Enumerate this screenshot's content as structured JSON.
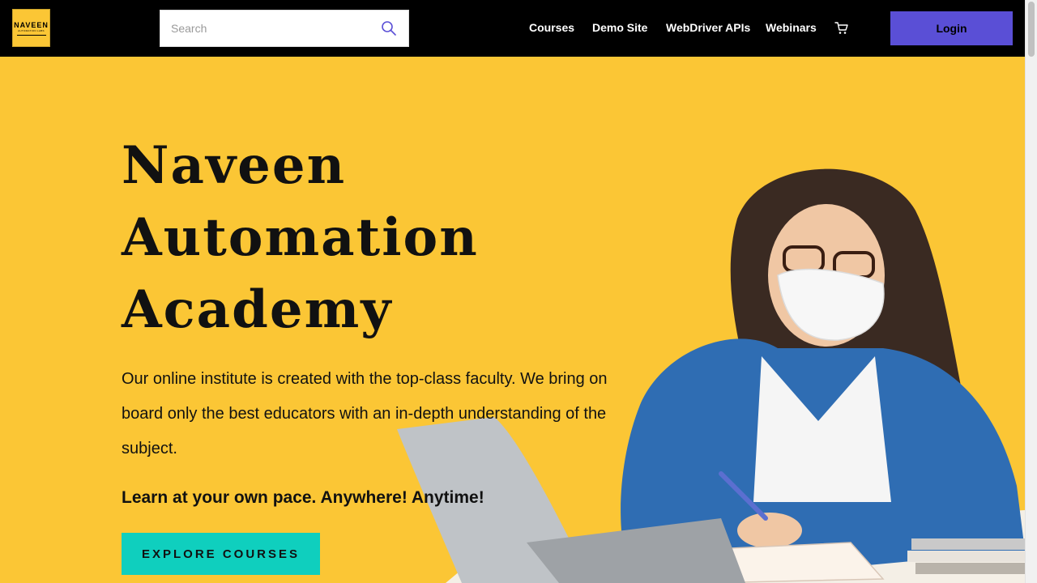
{
  "header": {
    "logo": {
      "line1": "NAVEEN",
      "line2": "AUTOMATION LABS"
    },
    "search": {
      "placeholder": "Search",
      "value": "",
      "icon": "search-icon"
    },
    "nav": [
      {
        "label": "Courses"
      },
      {
        "label": "Demo Site"
      },
      {
        "label": "WebDriver APIs"
      },
      {
        "label": "Webinars"
      }
    ],
    "cart_icon": "cart-icon",
    "login_label": "Login"
  },
  "hero": {
    "title_lines": [
      "Naveen",
      "Automation",
      "Academy"
    ],
    "description": "Our online institute is created with the top-class faculty. We bring on board only the best educators with an in-depth understanding of the subject.",
    "tagline": "Learn at your own pace. Anywhere! Anytime!",
    "cta_label": "EXPLORE COURSES"
  },
  "colors": {
    "hero_background": "#fbc635",
    "navbar": "#000000",
    "login_button": "#5a4fd6",
    "cta_button": "#0fcfbe",
    "search_icon": "#5a4fd6"
  }
}
